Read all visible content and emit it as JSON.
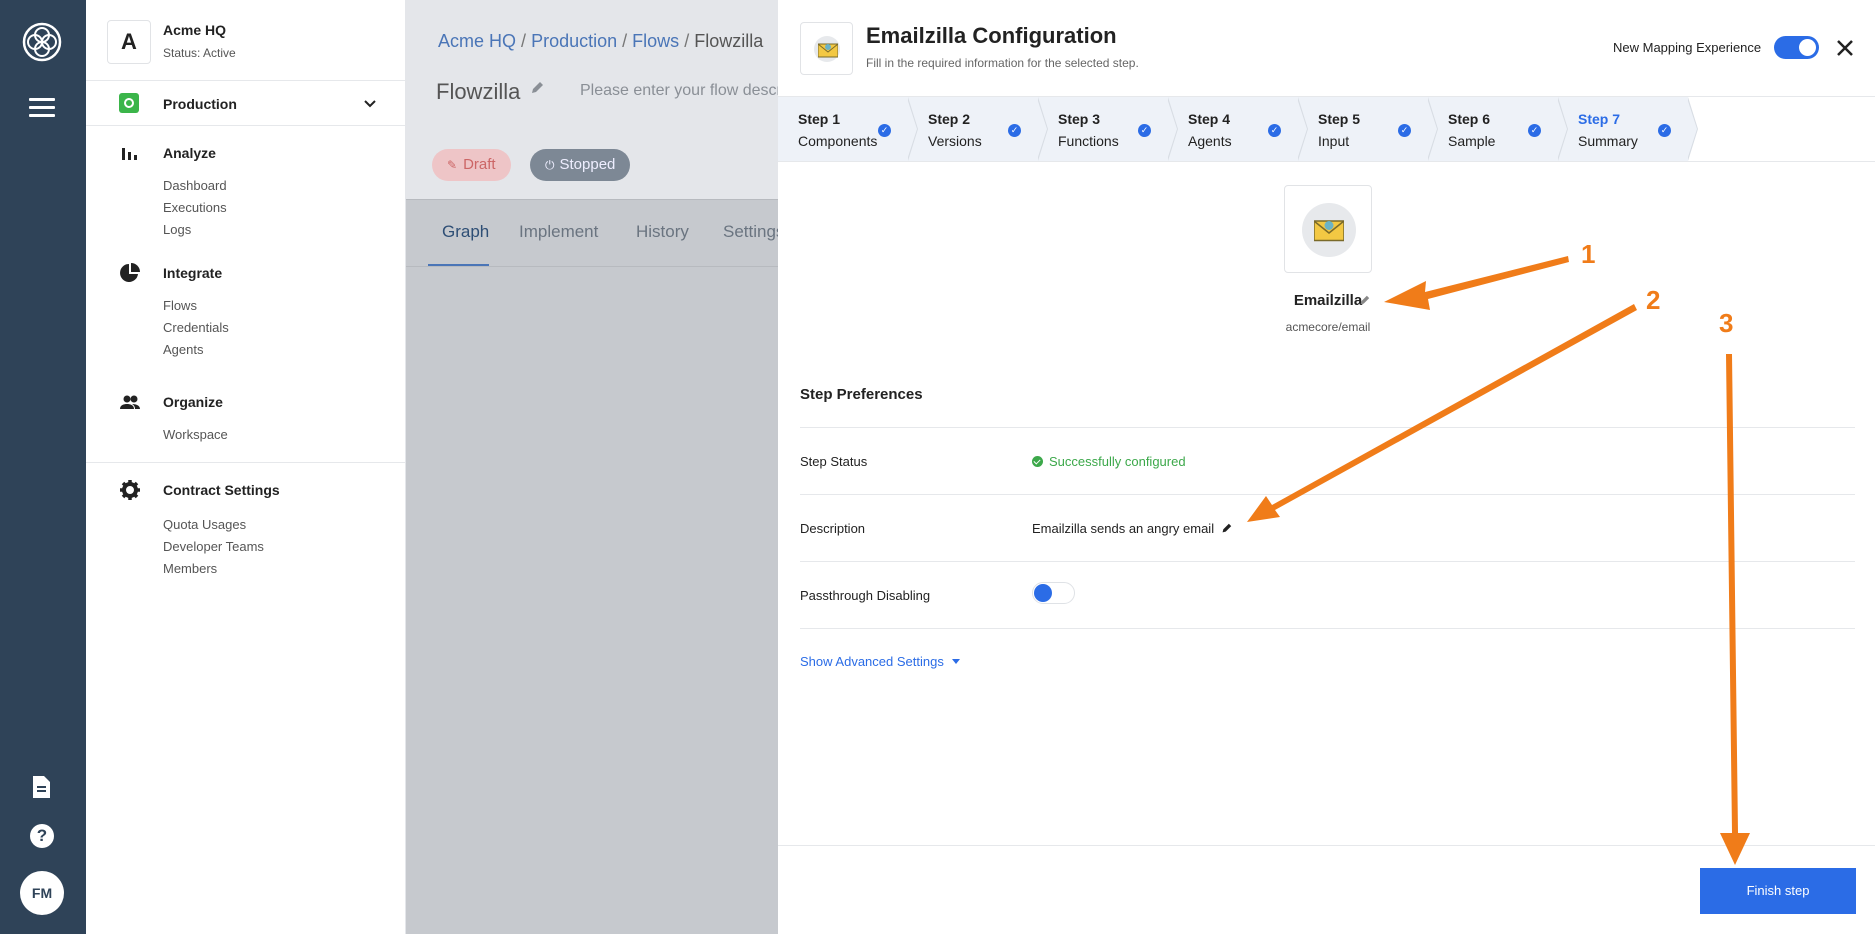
{
  "rail": {
    "logo_icon": "logo-icon",
    "menu_icon": "hamburger-menu-icon",
    "docs_icon": "document-icon",
    "help_icon": "help-icon",
    "help_glyph": "?",
    "avatar_initials": "FM"
  },
  "sidebar": {
    "tenant_letter": "A",
    "tenant_name": "Acme HQ",
    "tenant_status": "Status: Active",
    "workspace": "Production",
    "sections": [
      {
        "title": "Analyze",
        "items": [
          "Dashboard",
          "Executions",
          "Logs"
        ]
      },
      {
        "title": "Integrate",
        "items": [
          "Flows",
          "Credentials",
          "Agents"
        ]
      },
      {
        "title": "Organize",
        "items": [
          "Workspace"
        ]
      },
      {
        "title": "Contract Settings",
        "items": [
          "Quota Usages",
          "Developer Teams",
          "Members"
        ]
      }
    ]
  },
  "page": {
    "breadcrumb": [
      "Acme HQ",
      "Production",
      "Flows",
      "Flowzilla"
    ],
    "breadcrumb_sep": "/",
    "flow_name": "Flowzilla",
    "flow_description_placeholder": "Please enter your flow descr",
    "draft_label": "Draft",
    "stopped_label": "Stopped",
    "tabs": [
      "Graph",
      "Implement",
      "History",
      "Settings"
    ]
  },
  "panel": {
    "title": "Emailzilla Configuration",
    "subtitle": "Fill in the required information for the selected step.",
    "mapping_label": "New Mapping Experience",
    "mapping_enabled": true,
    "steps": [
      {
        "num": "Step 1",
        "name": "Components"
      },
      {
        "num": "Step 2",
        "name": "Versions"
      },
      {
        "num": "Step 3",
        "name": "Functions"
      },
      {
        "num": "Step 4",
        "name": "Agents"
      },
      {
        "num": "Step 5",
        "name": "Input"
      },
      {
        "num": "Step 6",
        "name": "Sample"
      },
      {
        "num": "Step 7",
        "name": "Summary"
      }
    ],
    "current_step": 7,
    "component_name": "Emailzilla",
    "component_path": "acmecore/email",
    "prefs_title": "Step Preferences",
    "rows": {
      "status_key": "Step Status",
      "status_value": "Successfully configured",
      "desc_key": "Description",
      "desc_value": "Emailzilla sends an angry email",
      "pass_key": "Passthrough Disabling"
    },
    "passthrough_enabled": false,
    "advanced_label": "Show Advanced Settings",
    "finish_label": "Finish step"
  },
  "annotations": [
    "1",
    "2",
    "3"
  ],
  "colors": {
    "rail": "#2f4358",
    "accent": "#2b6ce6",
    "success": "#3ca84a",
    "annotation": "#f07c19"
  }
}
